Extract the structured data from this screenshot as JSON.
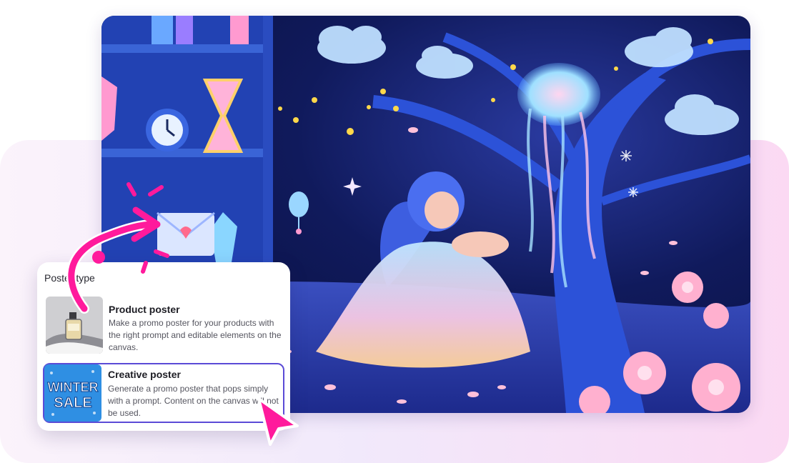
{
  "panel": {
    "title": "Poster type",
    "options": [
      {
        "title": "Product poster",
        "description": "Make a promo poster for your products with the right prompt and editable elements on the canvas.",
        "thumbnail_icon": "perfume-bottle-icon",
        "selected": false
      },
      {
        "title": "Creative poster",
        "description": "Generate a promo poster that pops simply with a prompt. Content on the canvas will not be used.",
        "thumbnail_text_line1": "WINTER",
        "thumbnail_text_line2": "SALE",
        "selected": true
      }
    ]
  },
  "colors": {
    "accent_magenta": "#ff1a9c",
    "selection_border": "#5b4bd6",
    "background_gradient_end": "#fbd9f3"
  },
  "decorations": {
    "arrow": "curved-arrow-icon",
    "cursor": "pointer-cursor-icon",
    "sparkle": "sparkle-lines-icon"
  }
}
